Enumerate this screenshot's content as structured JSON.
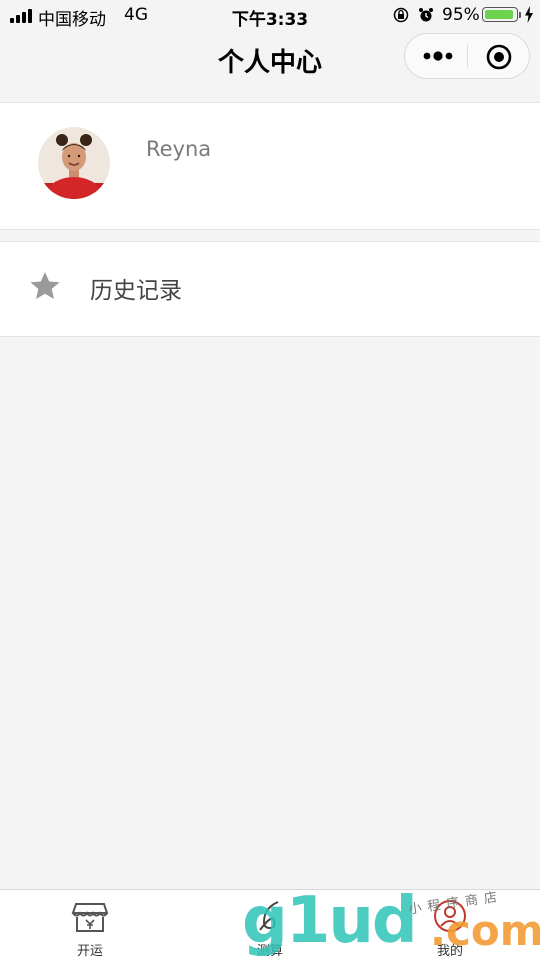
{
  "status_bar": {
    "carrier": "中国移动",
    "network": "4G",
    "time": "下午3:33",
    "battery_pct": "95%",
    "battery_level": 0.95,
    "battery_color": "#6cd44c"
  },
  "nav": {
    "title": "个人中心",
    "more_icon": "more-dots-icon",
    "close_icon": "target-circle-icon"
  },
  "profile": {
    "username": "Reyna",
    "avatar_icon": "user-avatar-photo"
  },
  "menu": {
    "history_label": "历史记录",
    "history_icon": "star-icon"
  },
  "tabbar": {
    "tabs": [
      {
        "label": "开运",
        "icon": "shop-icon"
      },
      {
        "label": "测算",
        "icon": "pen-icon"
      },
      {
        "label": "我的",
        "icon": "user-icon"
      }
    ]
  },
  "watermark": {
    "main": "g1ud",
    "suffix": ".com",
    "store": "小程序商店"
  }
}
